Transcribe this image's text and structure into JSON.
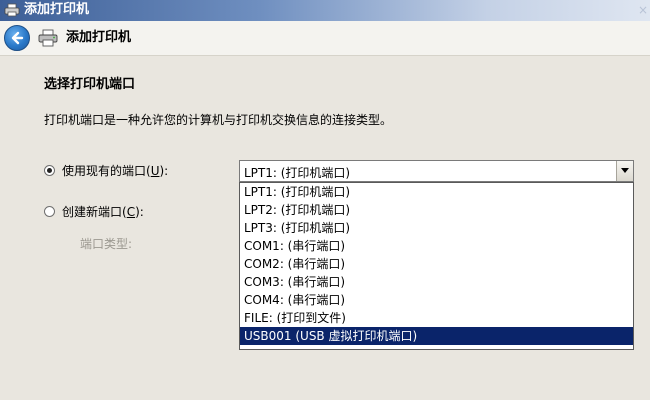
{
  "window": {
    "title": "添加打印机",
    "close_glyph": "×"
  },
  "nav": {
    "title": "添加打印机",
    "back_icon": "back-arrow-icon",
    "printer_icon": "printer-icon"
  },
  "page": {
    "heading": "选择打印机端口",
    "description": "打印机端口是一种允许您的计算机与打印机交换信息的连接类型。"
  },
  "options": {
    "use_existing": {
      "label_pre": "使用现有的端口(",
      "label_key": "U",
      "label_post": "):",
      "checked": true
    },
    "create_new": {
      "label_pre": "创建新端口(",
      "label_key": "C",
      "label_post": "):",
      "checked": false
    },
    "port_type_label": "端口类型:"
  },
  "port_select": {
    "selected": "LPT1: (打印机端口)",
    "items": [
      "LPT1: (打印机端口)",
      "LPT2: (打印机端口)",
      "LPT3: (打印机端口)",
      "COM1: (串行端口)",
      "COM2: (串行端口)",
      "COM3: (串行端口)",
      "COM4: (串行端口)",
      "FILE: (打印到文件)",
      "USB001 (USB 虚拟打印机端口)"
    ],
    "highlighted_index": 8
  },
  "colors": {
    "titlebar_start": "#3d5f97",
    "highlight": "#0a246a",
    "background": "#e9e6df"
  }
}
